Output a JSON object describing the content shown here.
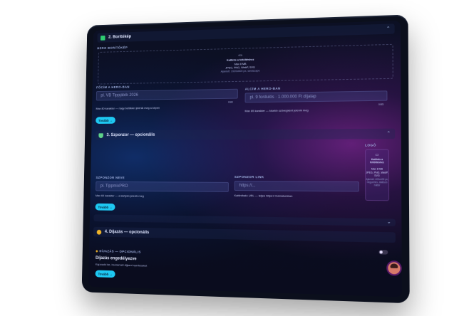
{
  "section2": {
    "title": "2. Borítókép",
    "icon_color": "#2ecc71",
    "icon": "image-icon"
  },
  "hero": {
    "label": "HERO BORÍTÓKÉP",
    "upload": {
      "line1": "Kattints a feltöltéshez",
      "line2": "Max 8 MB",
      "line3": "JPEG, PNG, WebP, SVG",
      "line4": "Ajánlott: 1920x600 px, landscape"
    }
  },
  "title_field": {
    "label": "FŐCÍM A HERO-BAN",
    "placeholder": "pl. VB Tippjáték 2026",
    "counter": "0/80",
    "hint": "Max 80 karakter — nagy betűkkel jelenik meg a képen"
  },
  "subtitle_field": {
    "label": "ALCÍM A HERO-BAN",
    "placeholder": "pl. 9 fordulós · 1.000.000 Ft díjalap",
    "counter": "0/85",
    "hint": "Max 85 karakter — kisebb szövegként jelenik meg"
  },
  "next1": "Tovább →",
  "section3": {
    "title": "3. Szponzor — opcionális",
    "icon_color": "#5fd38a",
    "icon": "shield-icon"
  },
  "logo": {
    "label": "LOGÓ",
    "line1": "Kattints a feltöltéshez",
    "line2": "Max 8 MB",
    "line3": "JPEG, PNG, WebP, SVG",
    "line4": "Ajánlott: 400x400 px, négyzetes, átlátszó háttér"
  },
  "sponsor_name": {
    "label": "SZPONZOR NEVE",
    "placeholder": "pl. TippmixPRO",
    "hint": "Max 60 karakter — a kártyán jelenik meg"
  },
  "sponsor_link": {
    "label": "SZPONZOR LINK",
    "placeholder": "https://...",
    "hint": "Kattintható URL — teljes https:// formátumban"
  },
  "next2": "Tovább →",
  "section4": {
    "title": "4. Díjazás — opcionális",
    "icon_color": "#f0b429",
    "icon": "medal-icon"
  },
  "prize": {
    "label": "DÍJAZÁS — OPCIONÁLIS",
    "title": "Díjazás engedélyezve",
    "desc": "Kapcsold be, ha kiemelt díjazni nyerteseket"
  },
  "next3": "Tovább →"
}
